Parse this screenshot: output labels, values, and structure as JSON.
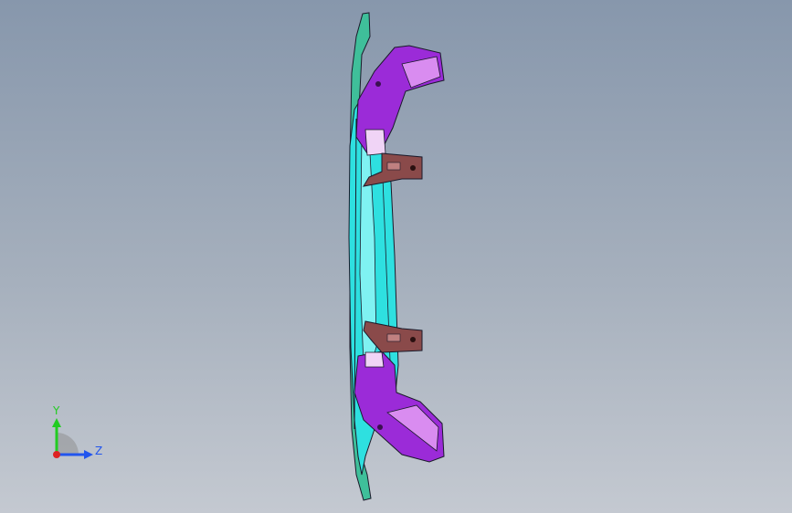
{
  "viewport": {
    "background_top": "#8797ac",
    "background_bottom": "#c4c9d1"
  },
  "part_colors": {
    "bracket": "#9b2bd8",
    "bracket_highlight": "#d98cf0",
    "bracket_light": "#f0d4f6",
    "rail": "#2ee0e0",
    "flange": "#3fbf9a",
    "clip": "#8a4a4a",
    "outline": "#1a1a2a"
  },
  "triad": {
    "y_label": "Y",
    "z_label": "Z",
    "y_color": "#22cc22",
    "z_color": "#2255ee",
    "origin_color": "#dd2222"
  }
}
